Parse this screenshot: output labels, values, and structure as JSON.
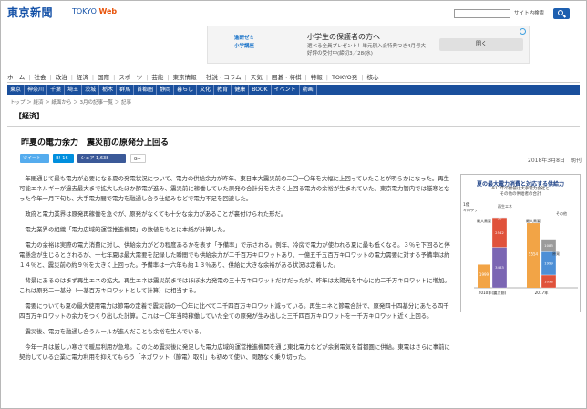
{
  "header": {
    "logo_jp": "東京新聞",
    "logo_en_a": "TOKYO",
    "logo_en_b": "Web",
    "site_search": "サイト内検索"
  },
  "ad": {
    "logo_line1": "進研ゼミ",
    "logo_line2": "小学講座",
    "title": "小学生の保護者の方へ",
    "body_line1": "選べる全員プレゼント！単元別入会特典つき4月号大",
    "body_line2": "好評の受付中(締切3／28(水)",
    "button": "開く"
  },
  "nav_main": [
    "ホーム",
    "社会",
    "政治",
    "経済",
    "国際",
    "スポーツ",
    "芸能",
    "東京情報",
    "社説・コラム",
    "天気",
    "囲碁・将棋",
    "特報",
    "TOKYO発",
    "核心"
  ],
  "nav_sub": [
    "東京",
    "神奈川",
    "千葉",
    "埼玉",
    "茨城",
    "栃木",
    "群馬",
    "首都圏",
    "静岡",
    "暮らし",
    "文化",
    "教育",
    "健康",
    "BOOK",
    "イベント",
    "動画"
  ],
  "breadcrumb": "トップ ＞ 経済 ＞ 紙面から ＞ 3月の記事一覧 ＞ 記事",
  "section_label": "【経済】",
  "headline": "昨夏の電力余力　震災前の原発分上回る",
  "share": {
    "tweet": "ツイート",
    "hatena": "B! 16",
    "facebook": "シェア 1,638",
    "gplus": "G+"
  },
  "date": "2018年3月8日　朝刊",
  "article": [
    "年間通じて最も電力が必要になる夏の発電状況について、電力の供給余力が昨年、東日本大震災前の二〇一〇年を大幅に上回っていたことが明らかになった。再生可能エネルギーが過去最大まで拡大したほか節電が進み、震災前に稼働していた原発の合計分を大きく上回る電力の余裕が生まれていた。東京電力管内では厳寒となった今年一月下旬も、大手電力間で電力を融通し合う仕組みなどで電力不足を回避した。",
    "政府と電力業界は原発再稼働を急ぐが、原発がなくても十分な余力があることが裏付けられた形だ。",
    "電力業界の組織「電力広域的運営推進機関」の数値をもとに本紙が計算した。",
    "電力の余裕は実際の電力消費に対し、供給余力がどの程度あるかを表す「予備率」で示される。例年、冷房で電力が使われる夏に最も低くなる。３％を下回ると停電懸念が生じるとされるが、一七年夏は最大需要を記録した瞬間でも供給余力が二千百万キロワットあり、一億五千五百万キロワットの電力需要に対する予備率は約１４％と、震災前の約９％を大きく上回った。予備率は一六年も約１３％あり、供給に大きな余裕がある状況は定着した。",
    "背景にあるのはまず再生エネの拡大。再生エネは震災前まではほぼ水力発電の三十万キロワットだけだったが、昨年は太陽光を中心に約二千万キロワットに増加。これは原発二十基分（一基百万キロワットとして計算）に相当する。",
    "需要についても夏の最大使用電力は節電の定着で震災前の一〇年に比べて二千四百万キロワット減っている。再生エネと節電合計で、原発四十四基分にあたる四千四百万キロワットの余力をつくり出した計算。これは一〇年当時稼働していた全ての原発が生み出した三千四百万キロワットを一千万キロワット近く上回る。",
    "震災後、電力を融通し合うルールが進んだことも余裕を生んでいる。",
    "今年一月は厳しい寒さで暖房利用が急増。このため震災後に発足した電力広域的運営推進機関を通じ東北電力などが余剰電気を首都圏に供給。東電はさらに事前に契約している企業に電力利用を抑えてもらう「ネガワット（節電）取引」も初めて使い、問題なく乗り切った。"
  ],
  "infographic": {
    "title": "夏の最大電力消費と対応する供給力",
    "sub_line1": "※17年の数値は大手電力会社と",
    "sub_line2": "その他の供給者の合計",
    "label_peak_demand": "予備率",
    "label_solar": "再生エネ",
    "label_reserve": "余力",
    "label_thermal": "火力",
    "label_nuclear": "原発",
    "label_other": "その他",
    "caption_2010": "最大需要",
    "caption_2017": "最大需要",
    "year_2010": "2010年(震災前)",
    "year_2017": "2017年",
    "axis_1": "1億",
    "axis_unit": "キロワット"
  },
  "chart_data": {
    "type": "bar",
    "title": "夏の最大電力消費と対応する供給力",
    "categories": [
      "2010年(震災前)",
      "2017年"
    ],
    "series": [
      {
        "name": "原発",
        "values": [
          3483,
          0
        ]
      },
      {
        "name": "火力",
        "values": [
          2542,
          1098
        ]
      },
      {
        "name": "再生エネ",
        "values": [
          30,
          1999
        ]
      },
      {
        "name": "その他",
        "values": [
          0,
          1083
        ]
      }
    ],
    "values_max_demand": [
      1999,
      5554
    ],
    "ylabel": "キロワット",
    "ylim": [
      0,
      18000
    ]
  },
  "colors": {
    "brand_blue": "#1a4f9c",
    "logo_blue": "#1552a8",
    "accent_orange": "#e8540c",
    "chart_orange": "#f2a446",
    "chart_purple": "#7b66b3",
    "chart_blue": "#4d8fd6",
    "chart_red": "#e0523b"
  }
}
